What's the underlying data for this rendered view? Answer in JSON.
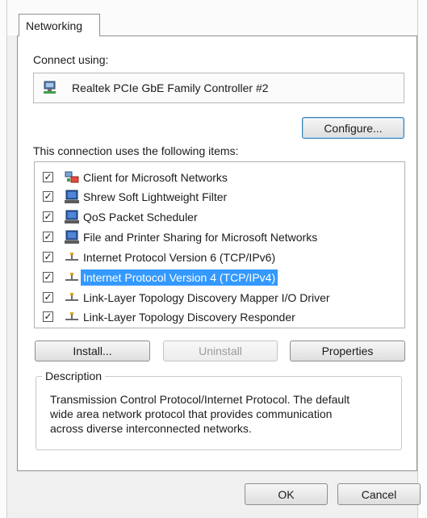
{
  "tabs": [
    {
      "label": "Networking"
    }
  ],
  "connect_using": {
    "label": "Connect using:",
    "adapter": "Realtek PCIe GbE Family Controller #2",
    "configure_button": "Configure..."
  },
  "items_section": {
    "label": "This connection uses the following items:",
    "items": [
      {
        "label": "Client for Microsoft Networks",
        "checked": true,
        "icon": "network-client-icon"
      },
      {
        "label": "Shrew Soft Lightweight Filter",
        "checked": true,
        "icon": "network-service-icon"
      },
      {
        "label": "QoS Packet Scheduler",
        "checked": true,
        "icon": "network-service-icon"
      },
      {
        "label": "File and Printer Sharing for Microsoft Networks",
        "checked": true,
        "icon": "network-service-icon"
      },
      {
        "label": "Internet Protocol Version 6 (TCP/IPv6)",
        "checked": true,
        "icon": "protocol-icon"
      },
      {
        "label": "Internet Protocol Version 4 (TCP/IPv4)",
        "checked": true,
        "icon": "protocol-icon",
        "selected": true
      },
      {
        "label": "Link-Layer Topology Discovery Mapper I/O Driver",
        "checked": true,
        "icon": "protocol-icon"
      },
      {
        "label": "Link-Layer Topology Discovery Responder",
        "checked": true,
        "icon": "protocol-icon"
      }
    ]
  },
  "buttons": {
    "install": "Install...",
    "uninstall": "Uninstall",
    "properties": "Properties",
    "ok": "OK",
    "cancel": "Cancel"
  },
  "description": {
    "title": "Description",
    "lines": [
      "Transmission Control Protocol/Internet Protocol. The default",
      "wide area network protocol that provides communication",
      "across diverse interconnected networks."
    ]
  },
  "colors": {
    "selection": "#3399ff",
    "dialog_background": "#f0f0f0",
    "focus_border": "#3c7fb1"
  }
}
